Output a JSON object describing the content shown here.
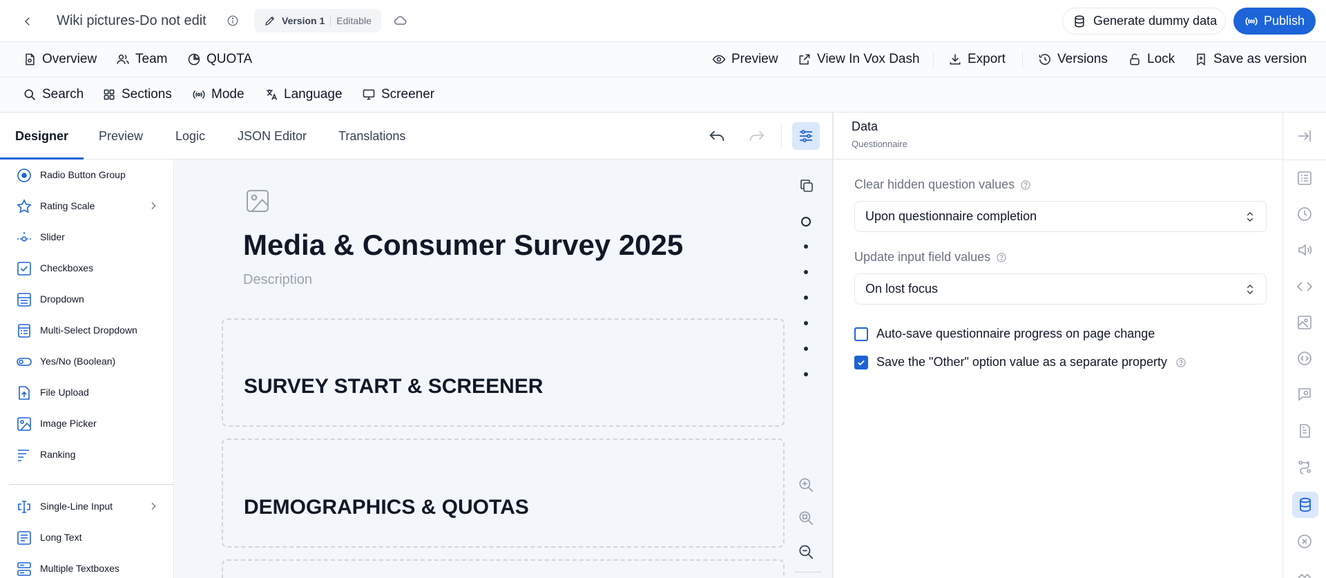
{
  "app": {
    "title": "Wiki pictures-Do not edit",
    "version": "Version 1",
    "version_status": "Editable",
    "generate_label": "Generate dummy data",
    "publish_label": "Publish",
    "accent_color": "#1d64d8"
  },
  "nav": {
    "overview": "Overview",
    "team": "Team",
    "quota": "QUOTA",
    "preview": "Preview",
    "view_vox_dash": "View In Vox Dash",
    "export": "Export",
    "versions": "Versions",
    "lock": "Lock",
    "save_as_version": "Save as version"
  },
  "tools_bar": {
    "search": "Search",
    "sections": "Sections",
    "mode": "Mode",
    "language": "Language",
    "screener": "Screener"
  },
  "tabs": {
    "designer": "Designer",
    "preview": "Preview",
    "logic": "Logic",
    "json_editor": "JSON Editor",
    "translations": "Translations"
  },
  "toolbox": [
    {
      "label": "Radio Button Group",
      "icon": "radio-button-icon",
      "chevron": false
    },
    {
      "label": "Rating Scale",
      "icon": "star-icon",
      "chevron": true
    },
    {
      "label": "Slider",
      "icon": "slider-icon",
      "chevron": false
    },
    {
      "label": "Checkboxes",
      "icon": "checkbox-icon",
      "chevron": false
    },
    {
      "label": "Dropdown",
      "icon": "dropdown-icon",
      "chevron": false
    },
    {
      "label": "Multi-Select Dropdown",
      "icon": "multi-select-icon",
      "chevron": false
    },
    {
      "label": "Yes/No (Boolean)",
      "icon": "toggle-icon",
      "chevron": false
    },
    {
      "label": "File Upload",
      "icon": "file-upload-icon",
      "chevron": false
    },
    {
      "label": "Image Picker",
      "icon": "image-picker-icon",
      "chevron": false
    },
    {
      "label": "Ranking",
      "icon": "ranking-icon",
      "chevron": false
    },
    {
      "label": "Single-Line Input",
      "icon": "text-cursor-icon",
      "chevron": true
    },
    {
      "label": "Long Text",
      "icon": "long-text-icon",
      "chevron": false
    },
    {
      "label": "Multiple Textboxes",
      "icon": "multiple-textboxes-icon",
      "chevron": false
    }
  ],
  "survey": {
    "title": "Media & Consumer Survey 2025",
    "description": "Description",
    "pages": [
      {
        "title": "SURVEY START & SCREENER"
      },
      {
        "title": "DEMOGRAPHICS & QUOTAS"
      }
    ]
  },
  "properties": {
    "title": "Data",
    "subtitle": "Questionnaire",
    "clear_hidden_label": "Clear hidden question values",
    "clear_hidden_value": "Upon questionnaire completion",
    "update_input_label": "Update input field values",
    "update_input_value": "On lost focus",
    "autosave_label": "Auto-save questionnaire progress on page change",
    "autosave_checked": false,
    "save_other_label": "Save the \"Other\" option value as a separate property",
    "save_other_checked": true
  }
}
